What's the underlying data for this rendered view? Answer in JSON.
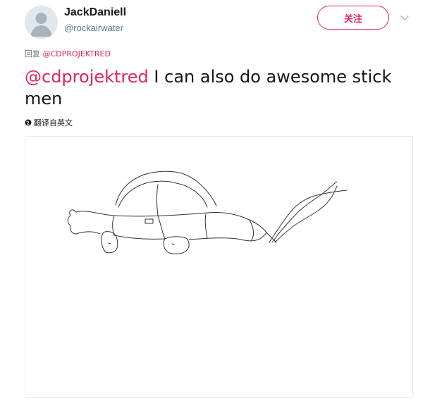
{
  "tweet": {
    "user": {
      "display_name": "JackDaniell",
      "handle": "@rockairwater",
      "avatar_icon": "default-avatar-icon"
    },
    "follow_label": "关注",
    "more_icon": "chevron-down-icon",
    "reply": {
      "prefix": "回复 ",
      "mention": "@CDPROJEKTRED"
    },
    "text": {
      "mention": "@cdprojektred",
      "body": " I can also do awesome stick men"
    },
    "translate": {
      "icon": "globe-icon",
      "label": "翻译自英文"
    },
    "media": {
      "icon": "car-sketch-drawing"
    }
  },
  "colors": {
    "accent": "#e0245e",
    "text": "#14171a",
    "muted": "#657786",
    "border": "#e6ecf0"
  }
}
